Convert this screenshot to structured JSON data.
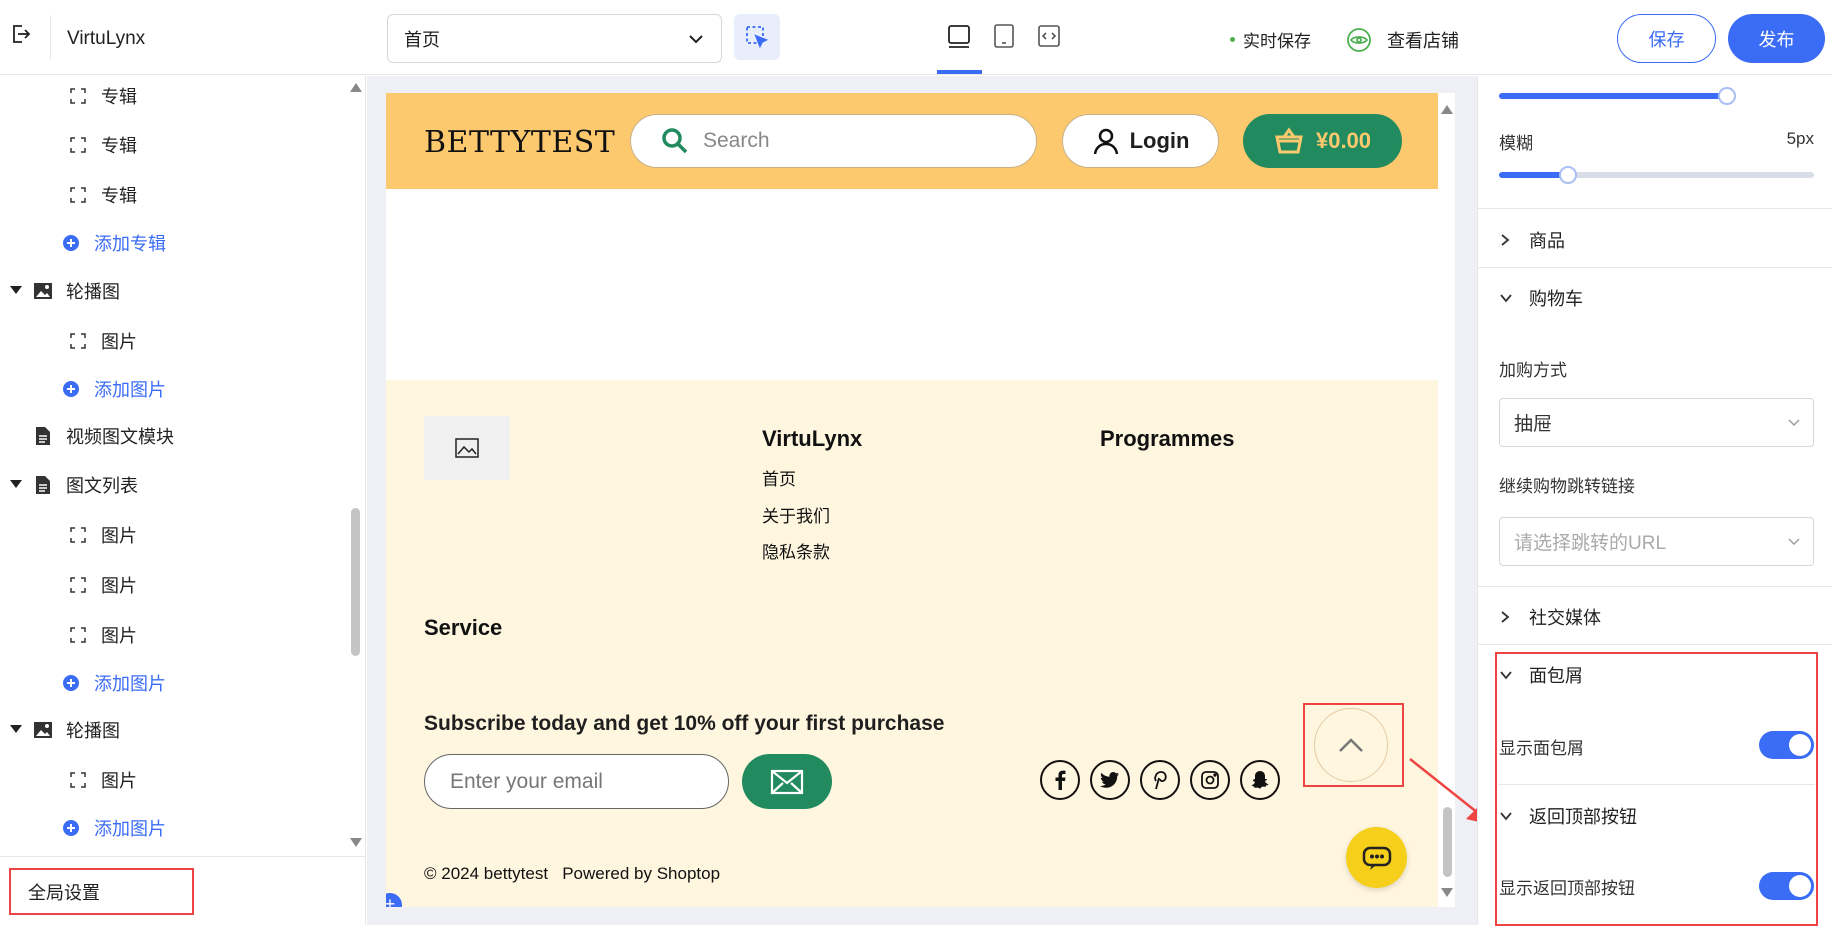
{
  "topbar": {
    "app_name": "VirtuLynx",
    "page_select": "首页",
    "autosave": "实时保存",
    "view_store": "查看店铺",
    "save": "保存",
    "publish": "发布"
  },
  "sidebar": {
    "items": [
      {
        "label": "专辑"
      },
      {
        "label": "专辑"
      },
      {
        "label": "专辑"
      },
      {
        "label": "添加专辑"
      },
      {
        "label": "轮播图"
      },
      {
        "label": "图片"
      },
      {
        "label": "添加图片"
      },
      {
        "label": "视频图文模块"
      },
      {
        "label": "图文列表"
      },
      {
        "label": "图片"
      },
      {
        "label": "图片"
      },
      {
        "label": "图片"
      },
      {
        "label": "添加图片"
      },
      {
        "label": "轮播图"
      },
      {
        "label": "图片"
      },
      {
        "label": "添加图片"
      }
    ],
    "global_settings": "全局设置"
  },
  "preview": {
    "header": {
      "logo": "BETTYTEST",
      "search_placeholder": "Search",
      "login": "Login",
      "cart_amount": "¥0.00"
    },
    "footer": {
      "col1_title": "VirtuLynx",
      "col1_links": [
        "首页",
        "关于我们",
        "隐私条款"
      ],
      "col2_title": "Programmes",
      "service_title": "Service",
      "subscribe_title": "Subscribe today and get 10% off your first purchase",
      "email_placeholder": "Enter your email",
      "copyright": "© 2024 bettytest",
      "powered_by": "Powered by Shoptop"
    },
    "social_icons": [
      "facebook-icon",
      "twitter-icon",
      "pinterest-icon",
      "instagram-icon",
      "snapchat-icon"
    ]
  },
  "right_panel": {
    "blur_label": "模糊",
    "blur_value": "5px",
    "slider_top_fraction": 0.61,
    "slider_blur_fraction": 0.22,
    "sections": {
      "products": "商品",
      "cart": "购物车",
      "add_method_label": "加购方式",
      "add_method_value": "抽屉",
      "continue_link_label": "继续购物跳转链接",
      "continue_link_placeholder": "请选择跳转的URL",
      "social_media": "社交媒体",
      "breadcrumb": "面包屑",
      "show_breadcrumb": "显示面包屑",
      "back_to_top": "返回顶部按钮",
      "show_back_to_top": "显示返回顶部按钮"
    },
    "toggles": {
      "show_breadcrumb": true,
      "show_back_to_top": true
    }
  },
  "colors": {
    "accent": "#3b6cf6",
    "header_bg": "#fdc96e",
    "footer_bg": "#fff6e0",
    "cart_green": "#218a5e",
    "highlight_red": "#ef4444",
    "chat_yellow": "#f5cf1a"
  }
}
